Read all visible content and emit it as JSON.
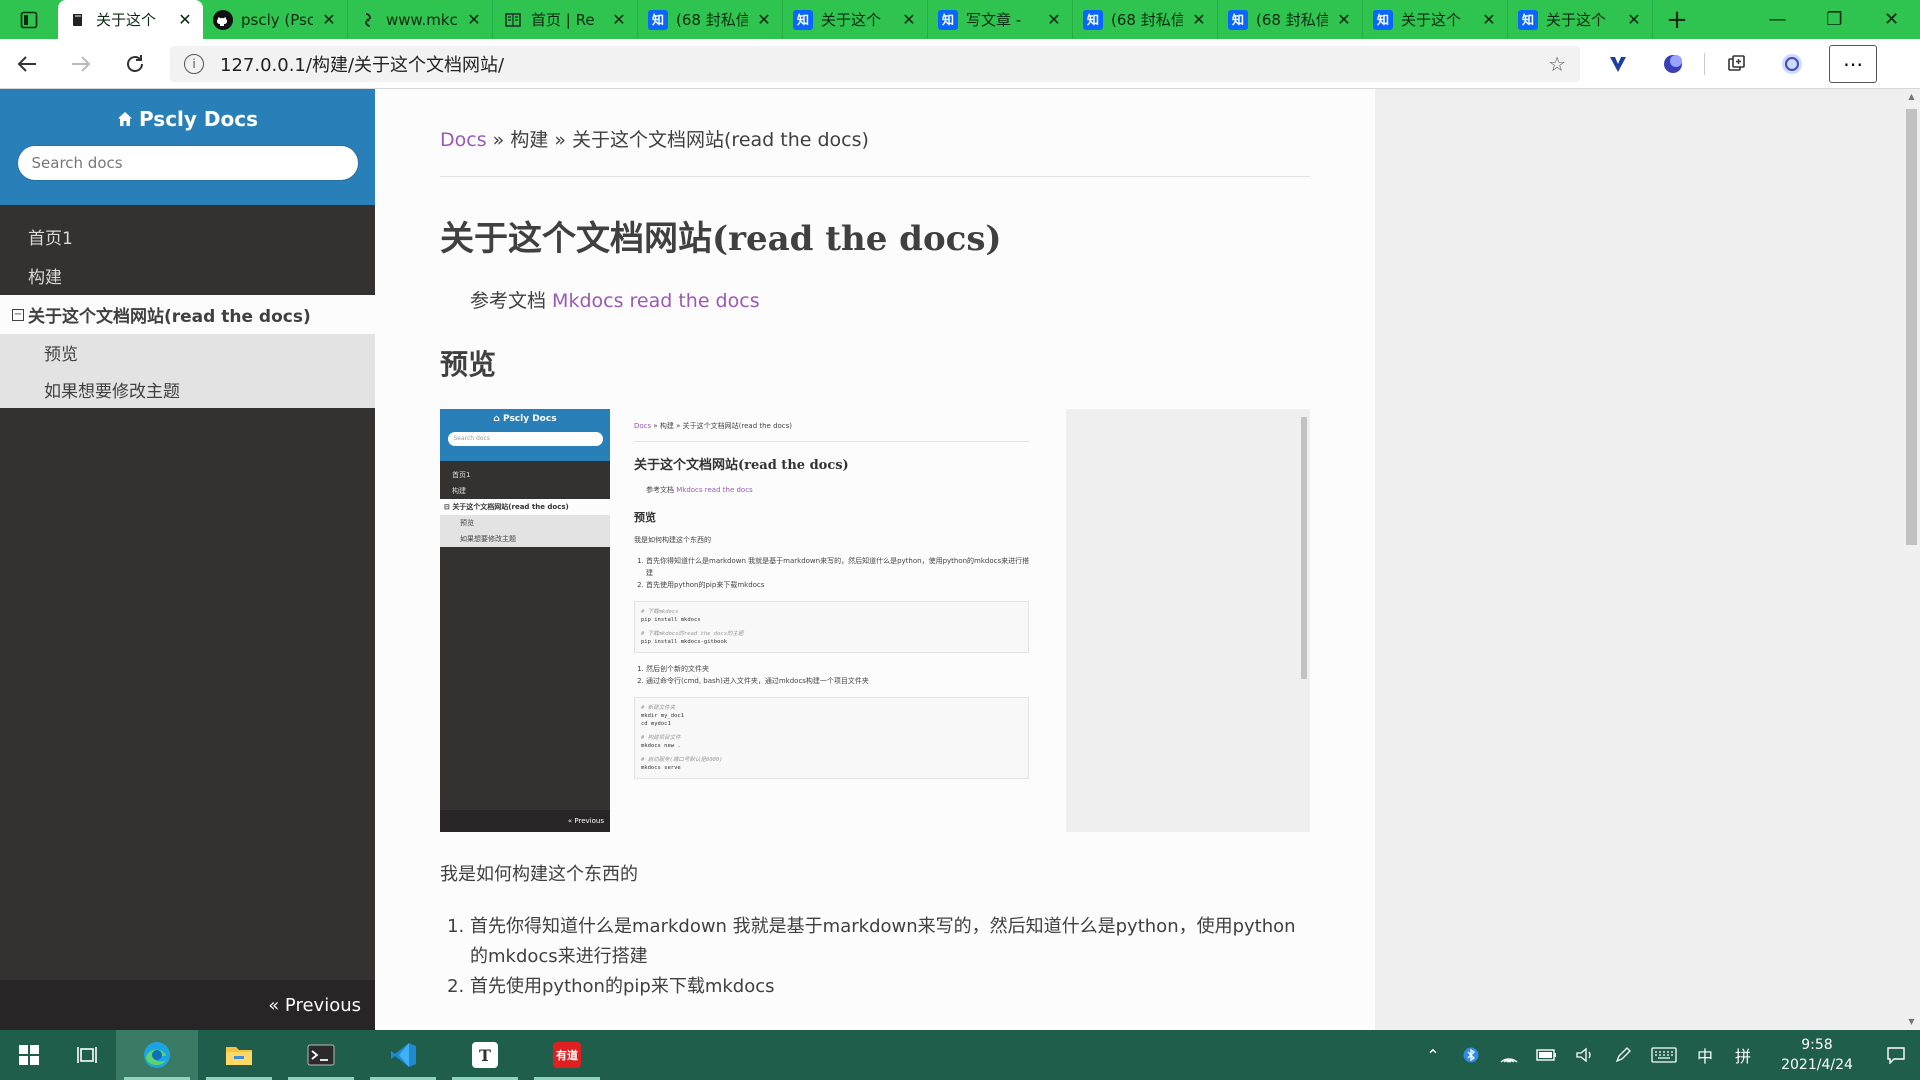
{
  "browser": {
    "tabs": [
      {
        "icon": "book-icon",
        "label": "关于这个",
        "active": true
      },
      {
        "icon": "github-icon",
        "label": "pscly (Psc"
      },
      {
        "icon": "web-icon",
        "label": "www.mkc"
      },
      {
        "icon": "reader-icon",
        "label": "首页 | Re"
      },
      {
        "icon": "zhihu-icon",
        "label": "(68 封私信"
      },
      {
        "icon": "zhihu-icon",
        "label": "关于这个"
      },
      {
        "icon": "zhihu-icon",
        "label": "写文章 -"
      },
      {
        "icon": "zhihu-icon",
        "label": "(68 封私信"
      },
      {
        "icon": "zhihu-icon",
        "label": "(68 封私信"
      },
      {
        "icon": "zhihu-icon",
        "label": "关于这个"
      },
      {
        "icon": "zhihu-icon",
        "label": "关于这个"
      }
    ],
    "zhihu_glyph": "知",
    "url": "127.0.0.1/构建/关于这个文档网站/",
    "accent": "#2ec44f"
  },
  "sidebar": {
    "brand": "Pscly Docs",
    "search_placeholder": "Search docs",
    "items": [
      {
        "label": "首页1"
      },
      {
        "label": "构建"
      }
    ],
    "current": "关于这个文档网站(read the docs)",
    "subitems": [
      {
        "label": "预览"
      },
      {
        "label": "如果想要修改主题"
      }
    ],
    "previous": "« Previous",
    "color_header": "#2980b9",
    "color_body": "#343131"
  },
  "main": {
    "breadcrumb_root": "Docs",
    "breadcrumb_rest": " » 构建 » 关于这个文档网站(read the docs)",
    "title": "关于这个文档网站(read the docs)",
    "ref_prefix": "参考文档 ",
    "ref_link": "Mkdocs read the docs",
    "section_preview": "预览",
    "para": "我是如何构建这个东西的",
    "steps": [
      "首先你得知道什么是markdown 我就是基于markdown来写的，然后知道什么是python，使用python的mkdocs来进行搭建",
      "首先使用python的pip来下载mkdocs"
    ],
    "link_color": "#9b59b6"
  },
  "mini": {
    "brand": "Pscly Docs",
    "search": "Search docs",
    "items": [
      "首页1",
      "构建"
    ],
    "current": "关于这个文档网站(read the docs)",
    "subitems": [
      "预览",
      "如果想要修改主题"
    ],
    "previous": "« Previous",
    "bc_root": "Docs",
    "bc_rest": " » 构建 » 关于这个文档网站(read the docs)",
    "title": "关于这个文档网站(read the docs)",
    "ref_prefix": "参考文档 ",
    "ref_link": "Mkdocs read the docs",
    "h2": "预览",
    "p1": "我是如何构建这个东西的",
    "ol1": [
      "首先你得知道什么是markdown 我就是基于markdown来写的，然后知道什么是python，使用python的mkdocs来进行搭建",
      "首先使用python的pip来下载mkdocs"
    ],
    "code1": [
      "# 下载mkdocs",
      "pip install mkdocs",
      "",
      "# 下载mkdocs的read the docs的主题",
      "pip install mkdocs-gitbook"
    ],
    "ol2": [
      "然后创个新的文件夹",
      "通过命令行(cmd, bash)进入文件夹，通过mkdocs构建一个项目文件夹"
    ],
    "code2": [
      "# 新建文件夹",
      "mkdir my_doc1",
      "cd mydoc1",
      "",
      "# 构建项目文件",
      "mkdocs new .",
      "",
      "# 启动服务(端口号默认是8000)",
      "mkdocs serve"
    ]
  },
  "taskbar": {
    "apps": [
      "edge-icon",
      "file-explorer-icon",
      "terminal-icon",
      "vscode-icon",
      "typora-icon",
      "youdao-icon"
    ],
    "ime": "中",
    "ime2": "拼",
    "time": "9:58",
    "date": "2021/4/24",
    "youdao_label": "有道",
    "typora_label": "T"
  }
}
